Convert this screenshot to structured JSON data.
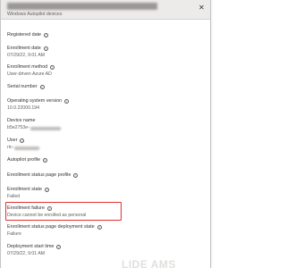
{
  "header": {
    "subtitle": "Windows Autopilot devices",
    "close_icon": "close-icon"
  },
  "fields": [
    {
      "label": "Registered date",
      "value": ""
    },
    {
      "label": "Enrollment date",
      "value": "07/29/22, 9:01 AM"
    },
    {
      "label": "Enrollment method",
      "value": "User-driven Azure AD"
    },
    {
      "label": "Serial number",
      "value": ""
    },
    {
      "label": "Operating system version",
      "value": "10.0.22000.194"
    },
    {
      "label": "Device name",
      "value": "b5e2753e-"
    },
    {
      "label": "User",
      "value": "ric-"
    },
    {
      "label": "Autopilot profile",
      "value": ""
    },
    {
      "label": "Enrollment status page profile",
      "value": ""
    },
    {
      "label": "Enrollment state",
      "value": "Failed"
    },
    {
      "label": "Enrollment failure",
      "value": "Device cannot be enrolled as personal"
    },
    {
      "label": "Enrollment status page deployment state",
      "value": "Failure"
    },
    {
      "label": "Deployment start time",
      "value": "07/29/22, 9:01 AM"
    }
  ],
  "info_icon": "info-icon",
  "watermark_text": "LIDE AMS",
  "colors": {
    "highlight": "#e0302d",
    "header_bg": "#edebe9"
  }
}
